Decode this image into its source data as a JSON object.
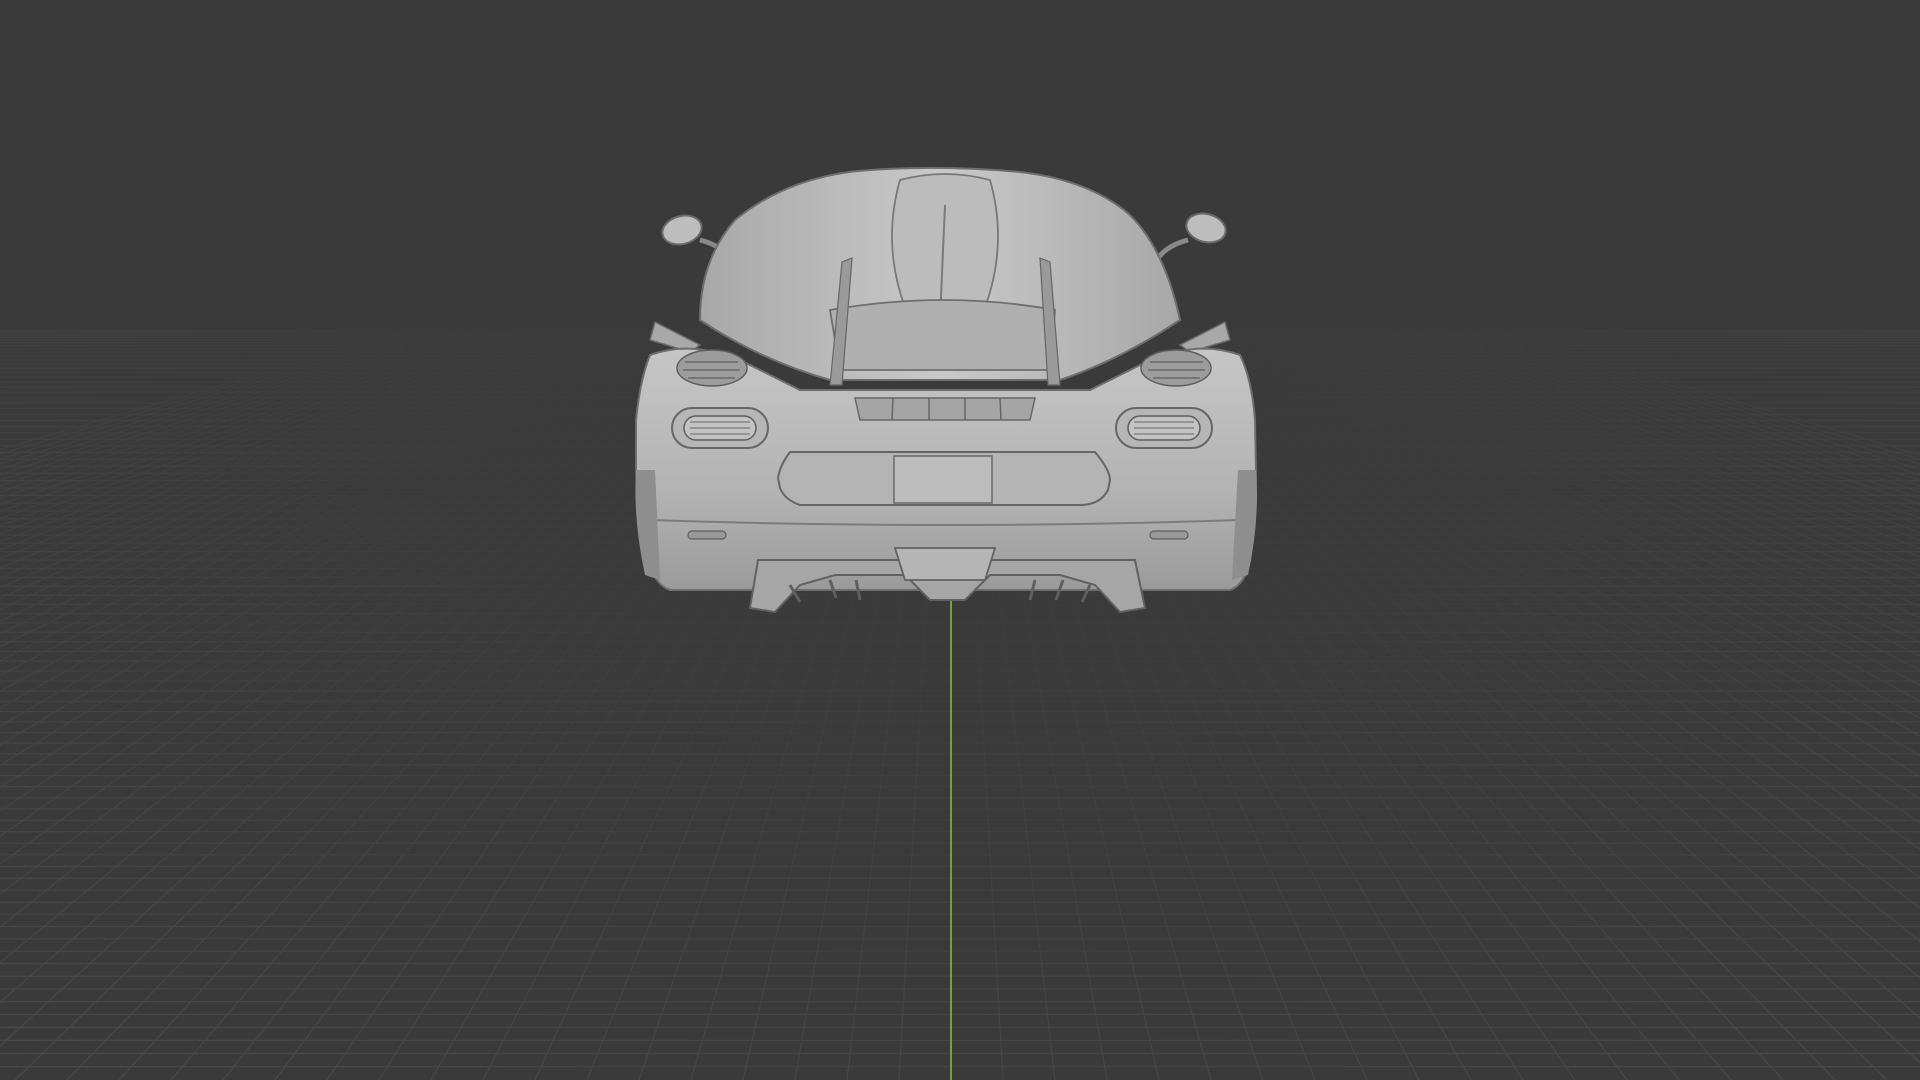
{
  "viewport": {
    "mode": "3d-view",
    "shading": "solid",
    "projection": "perspective",
    "grid_visible": true,
    "y_axis_visible": true,
    "object": "sports-car-mesh",
    "view_side": "rear"
  },
  "colors": {
    "background": "#3a3a3a",
    "grid_line": "#4a4a4a",
    "y_axis": "#6ea340",
    "mesh_base": "#b8b8b8",
    "mesh_shadow": "#8a8a8a",
    "mesh_dark": "#5a5a5a"
  }
}
